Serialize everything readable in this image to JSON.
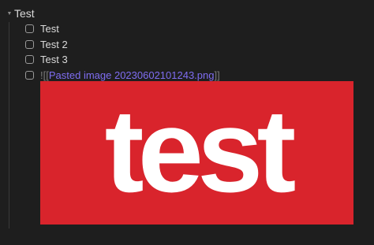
{
  "heading": {
    "text": "Test",
    "collapse_icon": "triangle-down-icon"
  },
  "tasks": [
    {
      "label": "Test",
      "checked": false
    },
    {
      "label": "Test 2",
      "checked": false
    },
    {
      "label": "Test 3",
      "checked": false
    }
  ],
  "embed_task": {
    "checked": false,
    "bang": "!",
    "open_brackets": "[[",
    "link_text": "Pasted image 20230602101243.png",
    "close_brackets": "]]"
  },
  "image": {
    "word": "test",
    "background_color": "#d9242c",
    "text_color": "#ffffff"
  },
  "colors": {
    "background": "#1e1e1e",
    "text": "#dadada",
    "link": "#7f6df2",
    "checkbox_border": "#9a9a9a"
  }
}
